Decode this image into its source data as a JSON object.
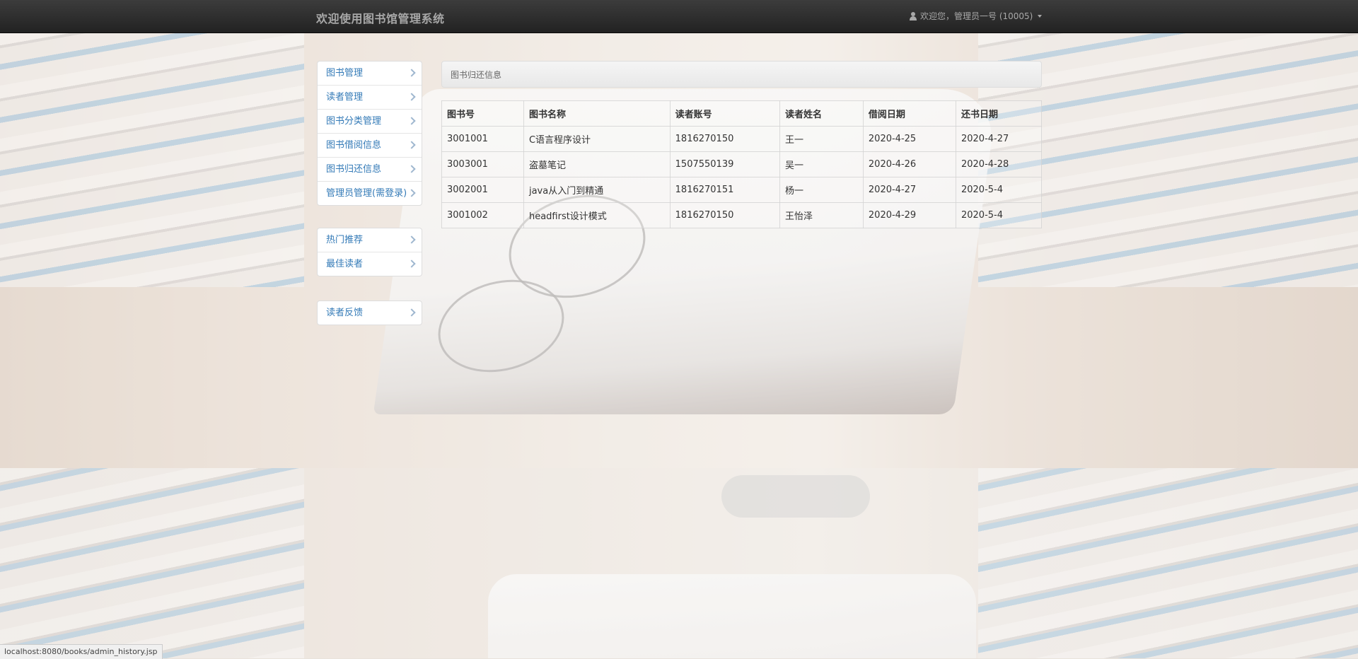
{
  "navbar": {
    "brand": "欢迎使用图书馆管理系统",
    "user_text": "欢迎您，管理员一号 (10005)",
    "user_icon": "user-icon"
  },
  "sidebar": {
    "group1": [
      {
        "label": "图书管理"
      },
      {
        "label": "读者管理"
      },
      {
        "label": "图书分类管理"
      },
      {
        "label": "图书借阅信息"
      },
      {
        "label": "图书归还信息"
      },
      {
        "label": "管理员管理(需登录)"
      }
    ],
    "group2": [
      {
        "label": "热门推荐"
      },
      {
        "label": "最佳读者"
      }
    ],
    "group3": [
      {
        "label": "读者反馈"
      }
    ]
  },
  "main": {
    "panel_title": "图书归还信息",
    "table": {
      "headers": [
        "图书号",
        "图书名称",
        "读者账号",
        "读者姓名",
        "借阅日期",
        "还书日期"
      ],
      "rows": [
        [
          "3001001",
          "C语言程序设计",
          "1816270150",
          "王一",
          "2020-4-25",
          "2020-4-27"
        ],
        [
          "3003001",
          "盗墓笔记",
          "1507550139",
          "吴一",
          "2020-4-26",
          "2020-4-28"
        ],
        [
          "3002001",
          "java从入门到精通",
          "1816270151",
          "杨一",
          "2020-4-27",
          "2020-5-4"
        ],
        [
          "3001002",
          "headfirst设计模式",
          "1816270150",
          "王怡泽",
          "2020-4-29",
          "2020-5-4"
        ]
      ]
    }
  },
  "statusbar": {
    "url": "localhost:8080/books/admin_history.jsp"
  },
  "colors": {
    "navbar_bg": "#222222",
    "link": "#337ab7"
  }
}
